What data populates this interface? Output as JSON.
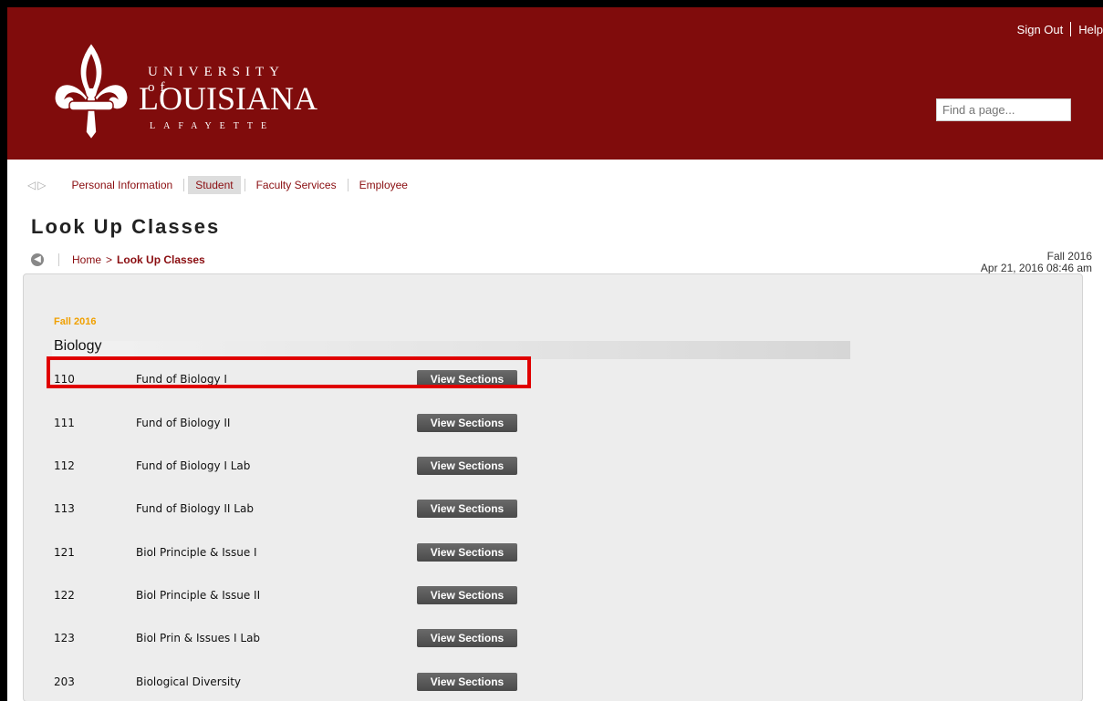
{
  "header": {
    "sign_out": "Sign Out",
    "help": "Help",
    "logo": {
      "line1": "UNIVERSITY of",
      "line2": "LOUISIANA",
      "line3": "LAFAYETTE"
    },
    "search_placeholder": "Find a page..."
  },
  "nav": {
    "items": [
      {
        "label": "Personal Information"
      },
      {
        "label": "Student"
      },
      {
        "label": "Faculty Services"
      },
      {
        "label": "Employee"
      }
    ]
  },
  "page": {
    "title": "Look Up Classes",
    "breadcrumb_home": "Home",
    "breadcrumb_sep": ">",
    "breadcrumb_current": "Look Up Classes",
    "term": "Fall 2016",
    "datetime": "Apr 21, 2016 08:46 am"
  },
  "listing": {
    "term": "Fall 2016",
    "subject": "Biology",
    "courses": [
      {
        "number": "110",
        "title": "Fund of Biology I",
        "button": "View Sections"
      },
      {
        "number": "111",
        "title": "Fund of Biology II",
        "button": "View Sections"
      },
      {
        "number": "112",
        "title": "Fund of Biology I Lab",
        "button": "View Sections"
      },
      {
        "number": "113",
        "title": "Fund of Biology II Lab",
        "button": "View Sections"
      },
      {
        "number": "121",
        "title": "Biol Principle & Issue I",
        "button": "View Sections"
      },
      {
        "number": "122",
        "title": "Biol Principle & Issue II",
        "button": "View Sections"
      },
      {
        "number": "123",
        "title": "Biol Prin & Issues I Lab",
        "button": "View Sections"
      },
      {
        "number": "203",
        "title": "Biological Diversity",
        "button": "View Sections"
      }
    ]
  },
  "colors": {
    "brand": "#800c0c",
    "term_accent": "#f0a000",
    "highlight": "#e00000"
  }
}
